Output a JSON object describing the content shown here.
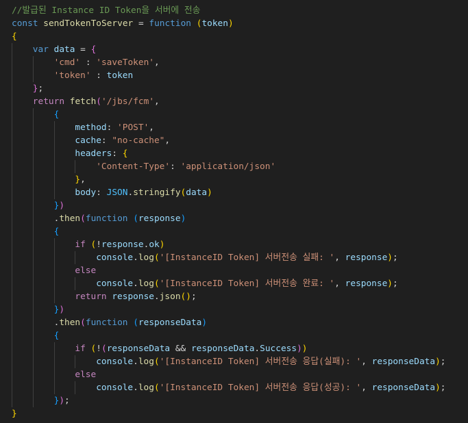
{
  "colors": {
    "background": "#1f1f1f",
    "comment": "#6a9955",
    "keyword": "#569cd6",
    "control": "#c586c0",
    "variable": "#9cdcfe",
    "function": "#dcdcaa",
    "string": "#ce9178",
    "bracket1": "#ffd700",
    "bracket2": "#da70d6",
    "bracket3": "#179fff"
  },
  "lines": [
    {
      "indent": 0,
      "tokens": [
        [
          "cm",
          "//발급된 Instance ID Token을 서버에 전송"
        ]
      ]
    },
    {
      "indent": 0,
      "tokens": [
        [
          "kw",
          "const"
        ],
        [
          "pn",
          " "
        ],
        [
          "fn",
          "sendTokenToServer"
        ],
        [
          "pn",
          " = "
        ],
        [
          "kw",
          "function"
        ],
        [
          "pn",
          " "
        ],
        [
          "b1",
          "("
        ],
        [
          "vr",
          "token"
        ],
        [
          "b1",
          ")"
        ]
      ]
    },
    {
      "indent": 0,
      "tokens": [
        [
          "b1",
          "{"
        ]
      ]
    },
    {
      "indent": 1,
      "tokens": [
        [
          "kw",
          "var"
        ],
        [
          "pn",
          " "
        ],
        [
          "vr",
          "data"
        ],
        [
          "pn",
          " = "
        ],
        [
          "b2",
          "{"
        ]
      ]
    },
    {
      "indent": 2,
      "tokens": [
        [
          "st",
          "'cmd'"
        ],
        [
          "pn",
          " : "
        ],
        [
          "st",
          "'saveToken'"
        ],
        [
          "pn",
          ","
        ]
      ]
    },
    {
      "indent": 2,
      "tokens": [
        [
          "st",
          "'token'"
        ],
        [
          "pn",
          " : "
        ],
        [
          "vr",
          "token"
        ]
      ]
    },
    {
      "indent": 1,
      "tokens": [
        [
          "b2",
          "}"
        ],
        [
          "pn",
          ";"
        ]
      ]
    },
    {
      "indent": 1,
      "tokens": [
        [
          "ct",
          "return"
        ],
        [
          "pn",
          " "
        ],
        [
          "fn",
          "fetch"
        ],
        [
          "b2",
          "("
        ],
        [
          "st",
          "'/jbs/fcm'"
        ],
        [
          "pn",
          ","
        ]
      ]
    },
    {
      "indent": 2,
      "tokens": [
        [
          "b3",
          "{"
        ]
      ]
    },
    {
      "indent": 3,
      "tokens": [
        [
          "vr",
          "method"
        ],
        [
          "pn",
          ": "
        ],
        [
          "st",
          "'POST'"
        ],
        [
          "pn",
          ","
        ]
      ]
    },
    {
      "indent": 3,
      "tokens": [
        [
          "vr",
          "cache"
        ],
        [
          "pn",
          ": "
        ],
        [
          "st",
          "\"no-cache\""
        ],
        [
          "pn",
          ","
        ]
      ]
    },
    {
      "indent": 3,
      "tokens": [
        [
          "vr",
          "headers"
        ],
        [
          "pn",
          ": "
        ],
        [
          "b1",
          "{"
        ]
      ]
    },
    {
      "indent": 4,
      "tokens": [
        [
          "st",
          "'Content-Type'"
        ],
        [
          "pn",
          ": "
        ],
        [
          "st",
          "'application/json'"
        ]
      ]
    },
    {
      "indent": 3,
      "tokens": [
        [
          "b1",
          "}"
        ],
        [
          "pn",
          ","
        ]
      ]
    },
    {
      "indent": 3,
      "tokens": [
        [
          "vr",
          "body"
        ],
        [
          "pn",
          ": "
        ],
        [
          "cn",
          "JSON"
        ],
        [
          "pn",
          "."
        ],
        [
          "fn",
          "stringify"
        ],
        [
          "b1",
          "("
        ],
        [
          "vr",
          "data"
        ],
        [
          "b1",
          ")"
        ]
      ]
    },
    {
      "indent": 2,
      "tokens": [
        [
          "b3",
          "}"
        ],
        [
          "b2",
          ")"
        ]
      ]
    },
    {
      "indent": 2,
      "tokens": [
        [
          "pn",
          "."
        ],
        [
          "fn",
          "then"
        ],
        [
          "b2",
          "("
        ],
        [
          "kw",
          "function"
        ],
        [
          "pn",
          " "
        ],
        [
          "b3",
          "("
        ],
        [
          "vr",
          "response"
        ],
        [
          "b3",
          ")"
        ]
      ]
    },
    {
      "indent": 2,
      "tokens": [
        [
          "b3",
          "{"
        ]
      ]
    },
    {
      "indent": 3,
      "tokens": [
        [
          "ct",
          "if"
        ],
        [
          "pn",
          " "
        ],
        [
          "b1",
          "("
        ],
        [
          "pn",
          "!"
        ],
        [
          "vr",
          "response"
        ],
        [
          "pn",
          "."
        ],
        [
          "vr",
          "ok"
        ],
        [
          "b1",
          ")"
        ]
      ]
    },
    {
      "indent": 4,
      "tokens": [
        [
          "vr",
          "console"
        ],
        [
          "pn",
          "."
        ],
        [
          "fn",
          "log"
        ],
        [
          "b1",
          "("
        ],
        [
          "st",
          "'[InstanceID Token] 서버전송 실패: '"
        ],
        [
          "pn",
          ", "
        ],
        [
          "vr",
          "response"
        ],
        [
          "b1",
          ")"
        ],
        [
          "pn",
          ";"
        ]
      ]
    },
    {
      "indent": 3,
      "tokens": [
        [
          "ct",
          "else"
        ]
      ]
    },
    {
      "indent": 4,
      "tokens": [
        [
          "vr",
          "console"
        ],
        [
          "pn",
          "."
        ],
        [
          "fn",
          "log"
        ],
        [
          "b1",
          "("
        ],
        [
          "st",
          "'[InstanceID Token] 서버전송 완료: '"
        ],
        [
          "pn",
          ", "
        ],
        [
          "vr",
          "response"
        ],
        [
          "b1",
          ")"
        ],
        [
          "pn",
          ";"
        ]
      ]
    },
    {
      "indent": 3,
      "tokens": [
        [
          "ct",
          "return"
        ],
        [
          "pn",
          " "
        ],
        [
          "vr",
          "response"
        ],
        [
          "pn",
          "."
        ],
        [
          "fn",
          "json"
        ],
        [
          "b1",
          "()"
        ],
        [
          "pn",
          ";"
        ]
      ]
    },
    {
      "indent": 2,
      "tokens": [
        [
          "b3",
          "}"
        ],
        [
          "b2",
          ")"
        ]
      ]
    },
    {
      "indent": 2,
      "tokens": [
        [
          "pn",
          "."
        ],
        [
          "fn",
          "then"
        ],
        [
          "b2",
          "("
        ],
        [
          "kw",
          "function"
        ],
        [
          "pn",
          " "
        ],
        [
          "b3",
          "("
        ],
        [
          "vr",
          "responseData"
        ],
        [
          "b3",
          ")"
        ]
      ]
    },
    {
      "indent": 2,
      "tokens": [
        [
          "b3",
          "{"
        ]
      ]
    },
    {
      "indent": 3,
      "tokens": [
        [
          "ct",
          "if"
        ],
        [
          "pn",
          " "
        ],
        [
          "b1",
          "("
        ],
        [
          "pn",
          "!"
        ],
        [
          "b2",
          "("
        ],
        [
          "vr",
          "responseData"
        ],
        [
          "pn",
          " && "
        ],
        [
          "vr",
          "responseData"
        ],
        [
          "pn",
          "."
        ],
        [
          "vr",
          "Success"
        ],
        [
          "b2",
          ")"
        ],
        [
          "b1",
          ")"
        ]
      ]
    },
    {
      "indent": 4,
      "tokens": [
        [
          "vr",
          "console"
        ],
        [
          "pn",
          "."
        ],
        [
          "fn",
          "log"
        ],
        [
          "b1",
          "("
        ],
        [
          "st",
          "'[InstanceID Token] 서버전송 응답(실패): '"
        ],
        [
          "pn",
          ", "
        ],
        [
          "vr",
          "responseData"
        ],
        [
          "b1",
          ")"
        ],
        [
          "pn",
          ";"
        ]
      ]
    },
    {
      "indent": 3,
      "tokens": [
        [
          "ct",
          "else"
        ]
      ]
    },
    {
      "indent": 4,
      "tokens": [
        [
          "vr",
          "console"
        ],
        [
          "pn",
          "."
        ],
        [
          "fn",
          "log"
        ],
        [
          "b1",
          "("
        ],
        [
          "st",
          "'[InstanceID Token] 서버전송 응답(성공): '"
        ],
        [
          "pn",
          ", "
        ],
        [
          "vr",
          "responseData"
        ],
        [
          "b1",
          ")"
        ],
        [
          "pn",
          ";"
        ]
      ]
    },
    {
      "indent": 2,
      "tokens": [
        [
          "b3",
          "}"
        ],
        [
          "b2",
          ")"
        ],
        [
          "pn",
          ";"
        ]
      ]
    },
    {
      "indent": 0,
      "tokens": [
        [
          "b1",
          "}"
        ]
      ]
    }
  ]
}
